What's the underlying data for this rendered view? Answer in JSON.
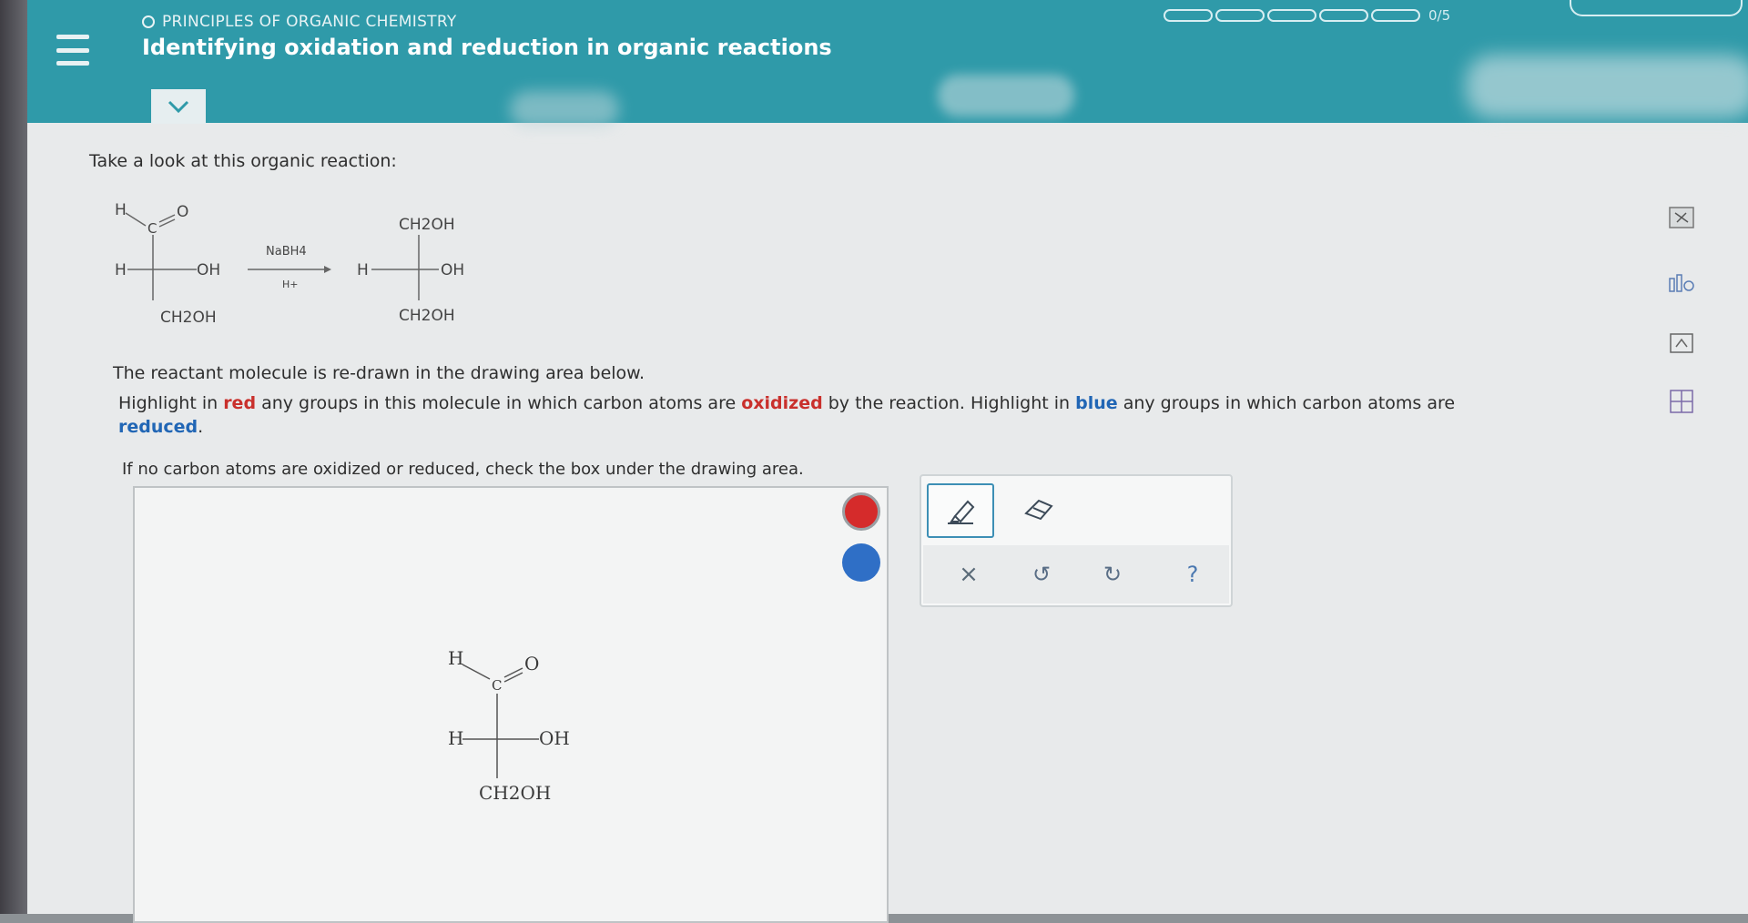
{
  "header": {
    "topic": "PRINCIPLES OF ORGANIC CHEMISTRY",
    "title": "Identifying oxidation and reduction in organic reactions",
    "progress_text": "0/5"
  },
  "content": {
    "prompt": "Take a look at this organic reaction:",
    "instruction1": "The reactant molecule is re-drawn in the drawing area below.",
    "instr2_a": "Highlight in ",
    "instr2_red": "red",
    "instr2_b": " any groups in this molecule in which carbon atoms are ",
    "instr2_oxidized": "oxidized",
    "instr2_c": " by the reaction. Highlight in ",
    "instr2_blue": "blue",
    "instr2_d": " any groups in which carbon atoms are ",
    "instr2_reduced": "reduced",
    "instr2_e": ".",
    "instruction3": "If no carbon atoms are oxidized or reduced, check the box under the drawing area."
  },
  "reaction": {
    "reactant": {
      "h_top": "H",
      "c_label": "C",
      "o_label": "O",
      "h_left": "H",
      "oh": "OH",
      "bottom": "CH2OH"
    },
    "reagent_top": "NaBH4",
    "reagent_bottom": "H+",
    "product": {
      "top": "CH2OH",
      "h_left": "H",
      "oh": "OH",
      "bottom": "CH2OH"
    }
  },
  "drawing_molecule": {
    "h_top": "H",
    "c_label": "C",
    "o_label": "O",
    "h_left": "H",
    "oh": "OH",
    "bottom": "CH2OH"
  },
  "colors": {
    "header": "#2f9aa9",
    "highlight_red": "#d52b2b",
    "highlight_blue": "#2f6fc6"
  },
  "toolbox": {
    "icons": [
      "highlighter-icon",
      "eraser-icon",
      "clear-icon",
      "undo-icon",
      "redo-icon",
      "help-icon"
    ],
    "clear_symbol": "×",
    "undo_symbol": "↺",
    "redo_symbol": "↻",
    "help_symbol": "?"
  },
  "side_tools": [
    "periodic-table-icon",
    "data-icon",
    "calculator-icon",
    "reference-icon"
  ]
}
